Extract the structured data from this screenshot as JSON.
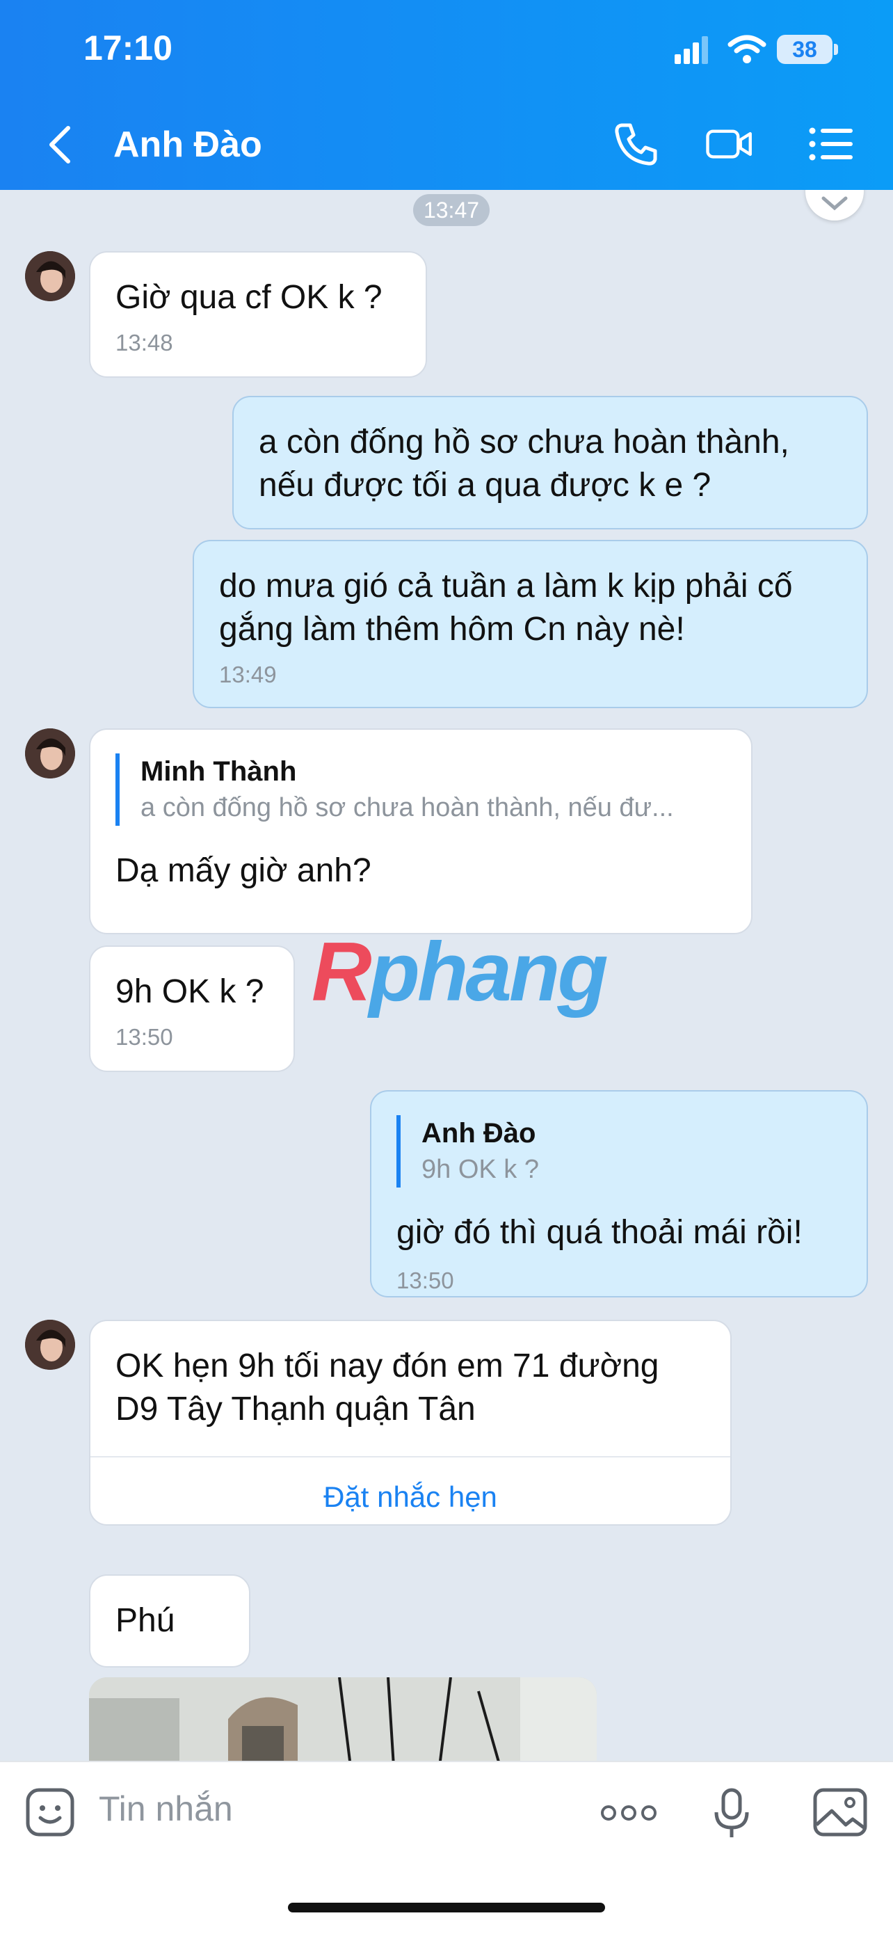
{
  "status_bar": {
    "time": "17:10",
    "battery": "38"
  },
  "header": {
    "title": "Anh Đào"
  },
  "messages": {
    "time_separator": "13:47",
    "m1": {
      "text": "Giờ qua cf  OK k ?",
      "time": "13:48"
    },
    "m2": {
      "text": "a còn đống hồ sơ chưa hoàn thành,\nnếu được tối a qua được k e ?"
    },
    "m3": {
      "text": "do mưa gió cả tuần a làm k kịp phải cố\ngắng làm thêm hôm Cn này nè!",
      "time": "13:49"
    },
    "m4": {
      "quote_author": "Minh Thành",
      "quote_text": "a còn đống hồ sơ chưa hoàn thành, nếu đư...",
      "text": "Dạ mấy giờ anh?"
    },
    "m5": {
      "text": "9h OK k ?",
      "time": "13:50"
    },
    "m6": {
      "quote_author": "Anh Đào",
      "quote_text": "9h OK k ?",
      "text": "giờ đó thì quá thoải mái rồi!",
      "time": "13:50"
    },
    "m7": {
      "text": "OK hẹn 9h tối nay đón em 71 đường\nD9 Tây Thạnh quận Tân",
      "action": "Đặt nhắc hẹn"
    },
    "m8": {
      "text": "Phú"
    }
  },
  "watermark": {
    "part1": "R",
    "part2": "phang"
  },
  "input": {
    "placeholder": "Tin nhắn"
  },
  "colors": {
    "header": "#1a82f2",
    "outgoing_bubble": "#d5eefd",
    "incoming_bubble": "#ffffff",
    "link": "#1a82f2"
  }
}
